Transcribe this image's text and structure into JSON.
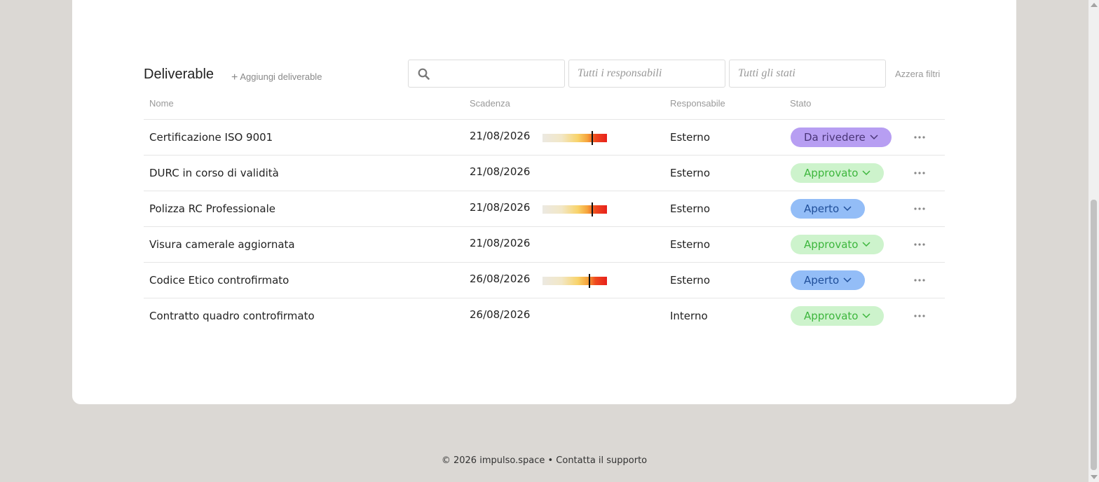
{
  "section": {
    "title": "Deliverable",
    "add_label": "Aggiungi deliverable",
    "search_placeholder": "",
    "filter_responsabile_placeholder": "Tutti i responsabili",
    "filter_stato_placeholder": "Tutti gli stati",
    "reset_label": "Azzera filtri"
  },
  "table": {
    "columns": {
      "name": "Nome",
      "deadline": "Scadenza",
      "owner": "Responsabile",
      "status": "Stato"
    },
    "rows": [
      {
        "name": "Certificazione ISO 9001",
        "deadline": "21/08/2026",
        "owner": "Esterno",
        "status": "Da rivedere",
        "status_color": "purple",
        "urgency": 0.76
      },
      {
        "name": "DURC in corso di validità",
        "deadline": "21/08/2026",
        "owner": "Esterno",
        "status": "Approvato",
        "status_color": "green",
        "urgency": null
      },
      {
        "name": "Polizza RC Professionale",
        "deadline": "21/08/2026",
        "owner": "Esterno",
        "status": "Aperto",
        "status_color": "blue",
        "urgency": 0.76
      },
      {
        "name": "Visura camerale aggiornata",
        "deadline": "21/08/2026",
        "owner": "Esterno",
        "status": "Approvato",
        "status_color": "green",
        "urgency": null
      },
      {
        "name": "Codice Etico controfirmato",
        "deadline": "26/08/2026",
        "owner": "Esterno",
        "status": "Aperto",
        "status_color": "blue",
        "urgency": 0.72
      },
      {
        "name": "Contratto quadro controfirmato",
        "deadline": "26/08/2026",
        "owner": "Interno",
        "status": "Approvato",
        "status_color": "green",
        "urgency": null
      }
    ]
  },
  "footer": {
    "text": "© 2026 impulso.space • Contatta il supporto"
  },
  "colors": {
    "background": "#dbd8d4",
    "card": "#ffffff",
    "purple_badge": "#b79ef2",
    "green_badge": "#cdf3cc",
    "blue_badge": "#93bdf7"
  }
}
